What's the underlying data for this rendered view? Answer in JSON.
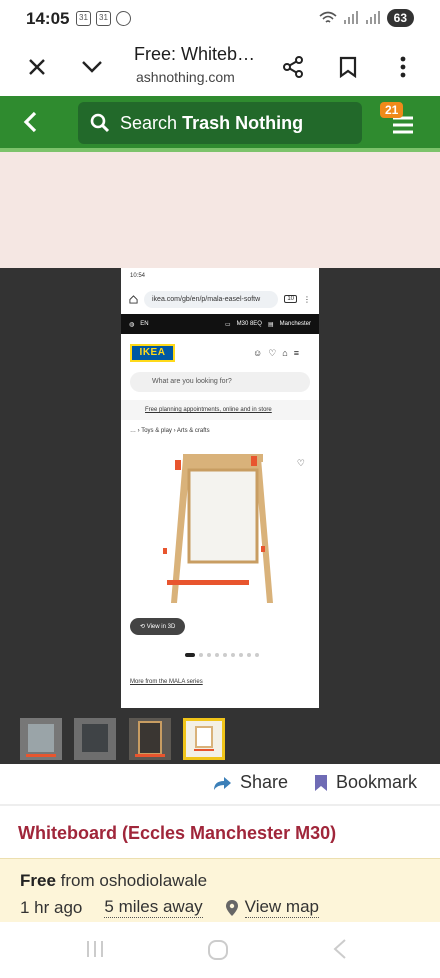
{
  "status_bar": {
    "time": "14:05",
    "calendar_icon_1": "31",
    "calendar_icon_2": "31",
    "battery": "63"
  },
  "browser": {
    "page_title": "Free: Whiteb…",
    "url": "ashnothing.com",
    "icons": [
      "close-icon",
      "chevron-down-icon",
      "share-icon",
      "bookmark-icon",
      "more-vert-icon"
    ]
  },
  "app_header": {
    "search_prefix": "Search",
    "search_bold": "Trash Nothing",
    "notifications": "21",
    "accent": "#2f8b2f"
  },
  "gallery": {
    "screenshot": {
      "time": "10:54",
      "url": "ikea.com/gb/en/p/mala-easel-softw",
      "tab_count": "10",
      "lang": "EN",
      "postcode": "M30 8EQ",
      "store": "Manchester",
      "logo": "IKEA",
      "search_placeholder": "What are you looking for?",
      "promo": "Free planning appointments, online and in store",
      "breadcrumb": "… › Toys & play › Arts & crafts",
      "view3d": "View in 3D",
      "series_link": "More from the MALA series"
    },
    "thumbnail_count": 4,
    "selected_thumbnail": 4
  },
  "actions": {
    "share_label": "Share",
    "bookmark_label": "Bookmark"
  },
  "item": {
    "title": "Whiteboard (Eccles Manchester M30)",
    "offer_type": "Free",
    "from_text": "from oshodiolawale",
    "time_ago": "1 hr ago",
    "distance": "5 miles away",
    "view_map": "View map"
  }
}
